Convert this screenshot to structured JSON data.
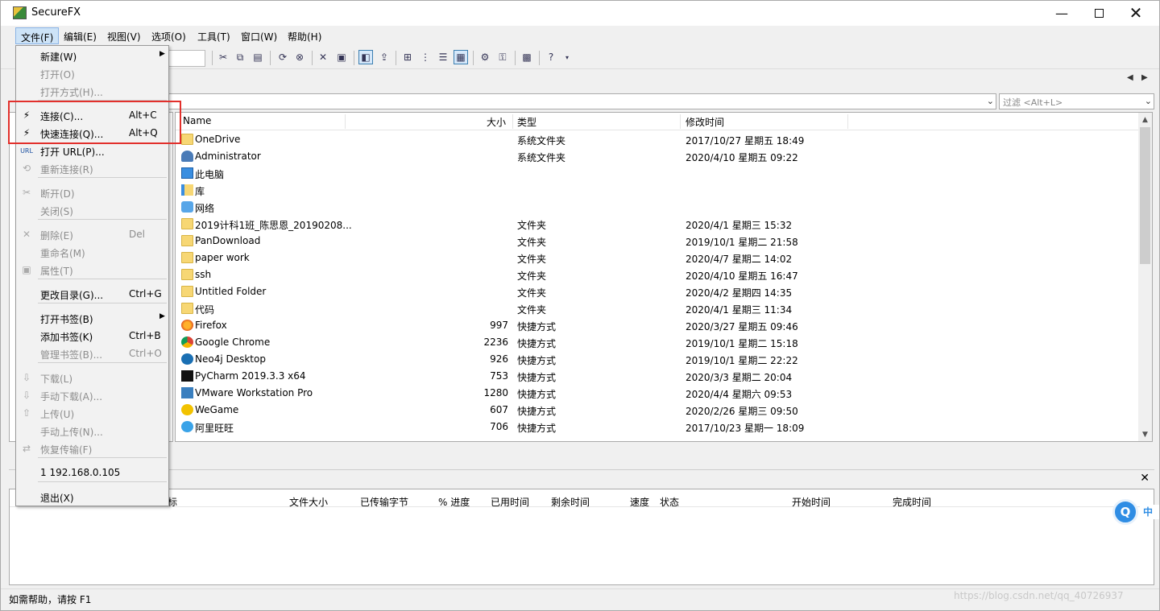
{
  "window": {
    "title": "SecureFX"
  },
  "menubar": [
    {
      "label": "文件(F)",
      "active": true
    },
    {
      "label": "编辑(E)"
    },
    {
      "label": "视图(V)"
    },
    {
      "label": "选项(O)"
    },
    {
      "label": "工具(T)"
    },
    {
      "label": "窗口(W)"
    },
    {
      "label": "帮助(H)"
    }
  ],
  "file_menu": [
    {
      "label": "新建(W)",
      "submenu": true
    },
    {
      "label": "打开(O)",
      "disabled": true
    },
    {
      "label": "打开方式(H)...",
      "disabled": true
    },
    {
      "label": "连接(C)...",
      "shortcut": "Alt+C",
      "icon": "connect-icon"
    },
    {
      "label": "快速连接(Q)...",
      "shortcut": "Alt+Q",
      "icon": "quick-connect-icon"
    },
    {
      "label": "打开 URL(P)...",
      "icon": "url-icon",
      "icon_text": "URL"
    },
    {
      "label": "重新连接(R)",
      "disabled": true,
      "icon": "reconnect-icon"
    },
    {
      "label": "断开(D)",
      "disabled": true,
      "icon": "disconnect-icon"
    },
    {
      "label": "关闭(S)",
      "disabled": true
    },
    {
      "label": "删除(E)",
      "shortcut": "Del",
      "disabled": true,
      "icon": "delete-icon"
    },
    {
      "label": "重命名(M)",
      "disabled": true
    },
    {
      "label": "属性(T)",
      "disabled": true,
      "icon": "properties-icon"
    },
    {
      "label": "更改目录(G)...",
      "shortcut": "Ctrl+G"
    },
    {
      "label": "打开书签(B)",
      "submenu": true
    },
    {
      "label": "添加书签(K)",
      "shortcut": "Ctrl+B"
    },
    {
      "label": "管理书签(B)...",
      "shortcut": "Ctrl+O",
      "disabled": true
    },
    {
      "label": "下载(L)",
      "disabled": true,
      "icon": "download-icon"
    },
    {
      "label": "手动下载(A)...",
      "disabled": true,
      "icon": "manual-download-icon"
    },
    {
      "label": "上传(U)",
      "disabled": true,
      "icon": "upload-icon"
    },
    {
      "label": "手动上传(N)...",
      "disabled": true
    },
    {
      "label": "恢复传输(F)",
      "disabled": true,
      "icon": "resume-transfer-icon"
    },
    {
      "label": "1 192.168.0.105"
    },
    {
      "label": "退出(X)"
    }
  ],
  "filter": {
    "placeholder": "过滤 <Alt+L>"
  },
  "file_list": {
    "columns": [
      "Name",
      "大小",
      "类型",
      "修改时间"
    ],
    "rows": [
      {
        "name": "OneDrive",
        "size": "",
        "type": "系统文件夹",
        "modified": "2017/10/27 星期五 18:49",
        "icon": "folder"
      },
      {
        "name": "Administrator",
        "size": "",
        "type": "系统文件夹",
        "modified": "2020/4/10 星期五 09:22",
        "icon": "user"
      },
      {
        "name": "此电脑",
        "size": "",
        "type": "",
        "modified": "",
        "icon": "pc"
      },
      {
        "name": "库",
        "size": "",
        "type": "",
        "modified": "",
        "icon": "lib"
      },
      {
        "name": "网络",
        "size": "",
        "type": "",
        "modified": "",
        "icon": "net"
      },
      {
        "name": "2019计科1班_陈思恩_20190208...",
        "size": "",
        "type": "文件夹",
        "modified": "2020/4/1 星期三 15:32",
        "icon": "folder"
      },
      {
        "name": "PanDownload",
        "size": "",
        "type": "文件夹",
        "modified": "2019/10/1 星期二 21:58",
        "icon": "folder"
      },
      {
        "name": "paper work",
        "size": "",
        "type": "文件夹",
        "modified": "2020/4/7 星期二 14:02",
        "icon": "folder"
      },
      {
        "name": "ssh",
        "size": "",
        "type": "文件夹",
        "modified": "2020/4/10 星期五 16:47",
        "icon": "folder"
      },
      {
        "name": "Untitled Folder",
        "size": "",
        "type": "文件夹",
        "modified": "2020/4/2 星期四 14:35",
        "icon": "folder"
      },
      {
        "name": "代码",
        "size": "",
        "type": "文件夹",
        "modified": "2020/4/1 星期三 11:34",
        "icon": "folder"
      },
      {
        "name": "Firefox",
        "size": "997",
        "type": "快捷方式",
        "modified": "2020/3/27 星期五 09:46",
        "icon": "ff"
      },
      {
        "name": "Google Chrome",
        "size": "2236",
        "type": "快捷方式",
        "modified": "2019/10/1 星期二 15:18",
        "icon": "chrome"
      },
      {
        "name": "Neo4j Desktop",
        "size": "926",
        "type": "快捷方式",
        "modified": "2019/10/1 星期二 22:22",
        "icon": "neo"
      },
      {
        "name": "PyCharm 2019.3.3 x64",
        "size": "753",
        "type": "快捷方式",
        "modified": "2020/3/3 星期二 20:04",
        "icon": "pycharm"
      },
      {
        "name": "VMware Workstation Pro",
        "size": "1280",
        "type": "快捷方式",
        "modified": "2020/4/4 星期六 09:53",
        "icon": "vmware"
      },
      {
        "name": "WeGame",
        "size": "607",
        "type": "快捷方式",
        "modified": "2020/2/26 星期三 09:50",
        "icon": "wegame"
      },
      {
        "name": "阿里旺旺",
        "size": "706",
        "type": "快捷方式",
        "modified": "2017/10/23 星期一 18:09",
        "icon": "ali"
      }
    ]
  },
  "queue": {
    "columns": [
      "标",
      "文件大小",
      "已传输字节",
      "% 进度",
      "已用时间",
      "剩余时间",
      "速度",
      "状态",
      "开始时间",
      "完成时间"
    ]
  },
  "statusbar": {
    "text": "如需帮助，请按 F1"
  },
  "watermark": "https://blog.csdn.net/qq_40726937",
  "ime": {
    "icon_letter": "Q",
    "label": "中"
  },
  "colors": {
    "highlight": "#e2302c",
    "menu_active": "#cde3f7"
  }
}
